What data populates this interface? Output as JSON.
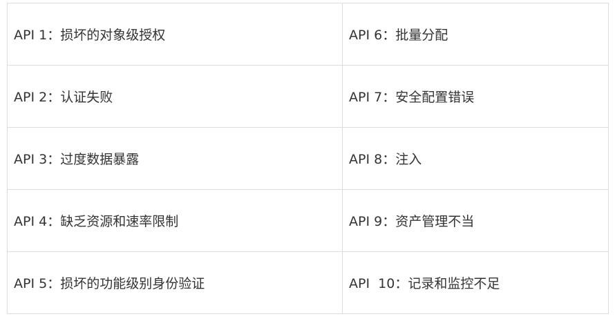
{
  "table": {
    "rows": [
      {
        "left": {
          "code": "API 1",
          "sep": "：",
          "text": "损坏的对象级授权"
        },
        "right": {
          "code": "API 6",
          "sep": "：",
          "text": "批量分配"
        }
      },
      {
        "left": {
          "code": "API 2",
          "sep": "：",
          "text": "认证失败"
        },
        "right": {
          "code": "API 7",
          "sep": "：",
          "text": "安全配置错误"
        }
      },
      {
        "left": {
          "code": "API 3",
          "sep": "：",
          "text": "过度数据暴露"
        },
        "right": {
          "code": "API 8",
          "sep": "：",
          "text": "注入"
        }
      },
      {
        "left": {
          "code": "API 4",
          "sep": "：",
          "text": "缺乏资源和速率限制"
        },
        "right": {
          "code": "API 9",
          "sep": "：",
          "text": "资产管理不当"
        }
      },
      {
        "left": {
          "code": "API 5",
          "sep": "：",
          "text": "损坏的功能级别身份验证"
        },
        "right": {
          "code": "API  10",
          "sep": "：",
          "text": "记录和监控不足"
        }
      }
    ]
  }
}
